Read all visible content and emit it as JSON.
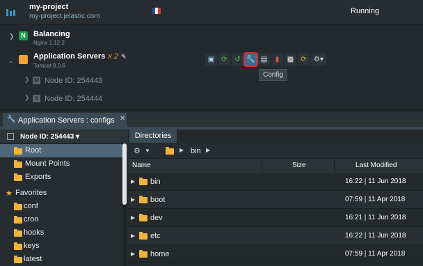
{
  "environment": {
    "name": "my-project",
    "domain": "my-project.jelastic.com",
    "status": "Running",
    "icon": "stack-icon",
    "region_flag_colors": [
      "#2b4a9c",
      "#f4f4f4",
      "#d8343a"
    ]
  },
  "nodes": [
    {
      "name": "Balancing",
      "version": "Nginx 1.12.2",
      "icon": "nginx-icon",
      "color": "#1a9b48"
    },
    {
      "name": "Application Servers",
      "count": "x 2",
      "version": "Tomcat 9.0.6",
      "icon": "tomcat-icon",
      "color": "#f0a13a"
    }
  ],
  "sub_nodes": [
    {
      "badge": "M",
      "label": "Node ID: 254443"
    },
    {
      "badge": "S",
      "label": "Node ID: 254444"
    }
  ],
  "toolbar": {
    "buttons": [
      "add-node-icon",
      "redeploy-icon",
      "restart-icon",
      "config-icon",
      "log-icon",
      "statistics-icon",
      "web-ssh-icon",
      "terminal-icon",
      "settings-icon"
    ],
    "tooltip": "Config"
  },
  "panel": {
    "tab_title": "Application Servers : configs",
    "node_select": "Node ID: 254443",
    "tree": [
      {
        "label": "Root",
        "selected": true
      },
      {
        "label": "Mount Points"
      },
      {
        "label": "Exports"
      }
    ],
    "favorites_label": "Favorites",
    "favorites": [
      "conf",
      "cron",
      "hooks",
      "keys",
      "latest"
    ]
  },
  "directories": {
    "tab": "Directories",
    "breadcrumb": [
      "bin"
    ],
    "columns": {
      "name": "Name",
      "size": "Size",
      "modified": "Last Modified"
    },
    "rows": [
      {
        "name": "bin",
        "modified": "16:22 | 11 Jun 2018"
      },
      {
        "name": "boot",
        "modified": "07:59 | 11 Apr 2018"
      },
      {
        "name": "dev",
        "modified": "16:21 | 11 Jun 2018"
      },
      {
        "name": "etc",
        "modified": "16:22 | 11 Jun 2018"
      },
      {
        "name": "home",
        "modified": "07:59 | 11 Apr 2018"
      }
    ]
  }
}
